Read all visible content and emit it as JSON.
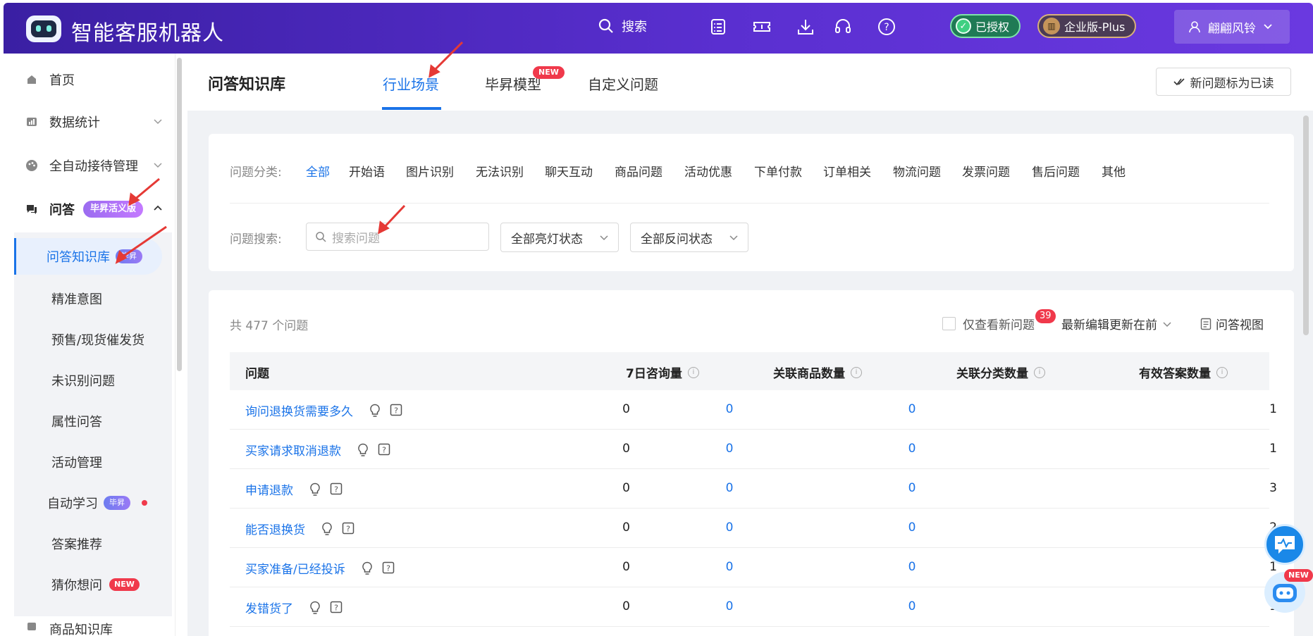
{
  "header": {
    "brand": "智能客服机器人",
    "search_label": "搜索",
    "auth_badge": "已授权",
    "edition_badge": "企业版-Plus",
    "user_name": "翩翩风铃"
  },
  "sidebar": {
    "items": [
      {
        "label": "首页"
      },
      {
        "label": "数据统计"
      },
      {
        "label": "全自动接待管理"
      },
      {
        "label": "问答",
        "badge": "毕昇活义版"
      }
    ],
    "sub_items": [
      {
        "label": "问答知识库",
        "badge": "毕昇"
      },
      {
        "label": "精准意图"
      },
      {
        "label": "预售/现货催发货"
      },
      {
        "label": "未识别问题"
      },
      {
        "label": "属性问答"
      },
      {
        "label": "活动管理"
      },
      {
        "label": "自动学习",
        "badge": "毕昇"
      },
      {
        "label": "答案推荐"
      },
      {
        "label": "猜你想问",
        "badge": "NEW"
      }
    ],
    "next_item": "商品知识库"
  },
  "main": {
    "title": "问答知识库",
    "tabs": [
      {
        "label": "行业场景"
      },
      {
        "label": "毕昇模型",
        "badge": "NEW"
      },
      {
        "label": "自定义问题"
      }
    ],
    "mark_read_label": "新问题标为已读"
  },
  "filters": {
    "category_label": "问题分类:",
    "categories": [
      "全部",
      "开始语",
      "图片识别",
      "无法识别",
      "聊天互动",
      "商品问题",
      "活动优惠",
      "下单付款",
      "订单相关",
      "物流问题",
      "发票问题",
      "售后问题",
      "其他"
    ],
    "search_label": "问题搜索:",
    "search_placeholder": "搜索问题",
    "light_status": "全部亮灯状态",
    "feedback_status": "全部反问状态"
  },
  "list": {
    "total_text": "共 477 个问题",
    "only_new_label": "仅查看新问题",
    "new_count": "39",
    "sort_label": "最新编辑更新在前",
    "view_label": "问答视图",
    "columns": [
      "问题",
      "7日咨询量",
      "关联商品数量",
      "关联分类数量",
      "有效答案数量"
    ],
    "rows": [
      {
        "question": "询问退换货需要多久",
        "consult": "0",
        "goods": "0",
        "cats": "0",
        "answers": "1"
      },
      {
        "question": "买家请求取消退款",
        "consult": "0",
        "goods": "0",
        "cats": "0",
        "answers": "1"
      },
      {
        "question": "申请退款",
        "consult": "0",
        "goods": "0",
        "cats": "0",
        "answers": "3"
      },
      {
        "question": "能否退换货",
        "consult": "0",
        "goods": "0",
        "cats": "0",
        "answers": "2"
      },
      {
        "question": "买家准备/已经投诉",
        "consult": "0",
        "goods": "0",
        "cats": "0",
        "answers": "1"
      },
      {
        "question": "发错货了",
        "consult": "0",
        "goods": "0",
        "cats": "0",
        "answers": "1"
      }
    ]
  },
  "floating": {
    "new_badge": "NEW"
  },
  "colors": {
    "accent": "#1a73e8",
    "header": "#4a27c0",
    "danger": "#f0394b"
  }
}
